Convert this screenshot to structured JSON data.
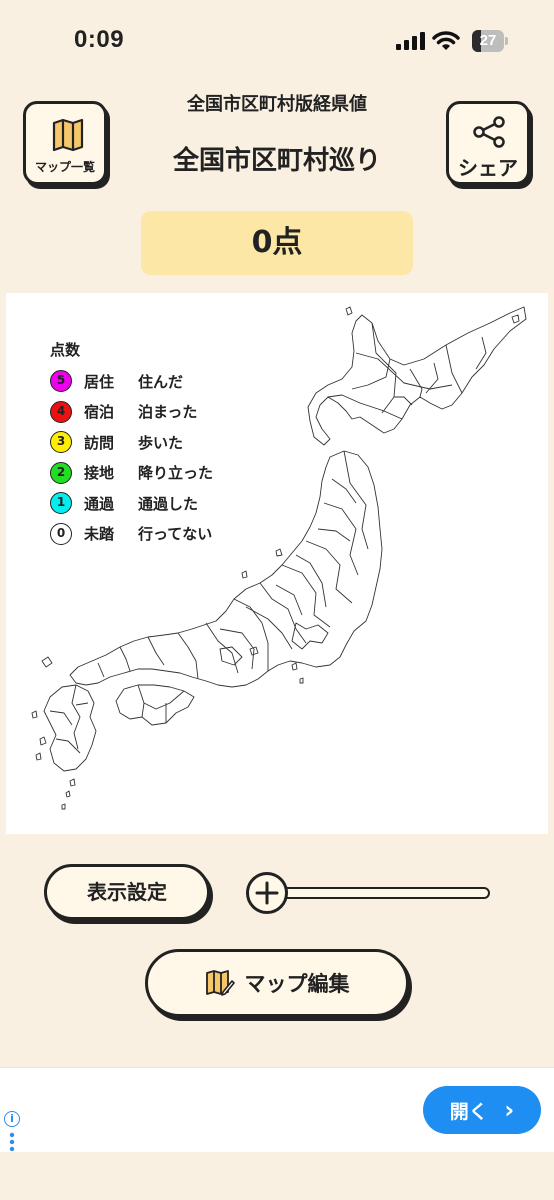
{
  "status_bar": {
    "time": "0:09",
    "battery": "27",
    "battery_fraction": 0.27
  },
  "header": {
    "subtitle": "全国市区町村版経県値",
    "title": "全国市区町村巡り",
    "map_list_label": "マップ一覧",
    "share_label": "シェア"
  },
  "score": "0点",
  "legend": {
    "title": "点数",
    "items": [
      {
        "points": "5",
        "level": "居住",
        "desc": "住んだ",
        "color": "#ee00ee"
      },
      {
        "points": "4",
        "level": "宿泊",
        "desc": "泊まった",
        "color": "#ee1111"
      },
      {
        "points": "3",
        "level": "訪問",
        "desc": "歩いた",
        "color": "#ffee00"
      },
      {
        "points": "2",
        "level": "接地",
        "desc": "降り立った",
        "color": "#22dd22"
      },
      {
        "points": "1",
        "level": "通過",
        "desc": "通過した",
        "color": "#00eeee"
      },
      {
        "points": "0",
        "level": "未踏",
        "desc": "行ってない",
        "color": "#ffffff"
      }
    ]
  },
  "controls": {
    "display_settings": "表示設定",
    "map_edit": "マップ編集",
    "zoom_level": 0
  },
  "ad": {
    "open_label": "開く",
    "open_chevron": "›"
  },
  "colors": {
    "background": "#faf0e2",
    "score_bg": "#fde7a6",
    "button_bg": "#fff8e8",
    "ad_button": "#1e8ef3"
  }
}
